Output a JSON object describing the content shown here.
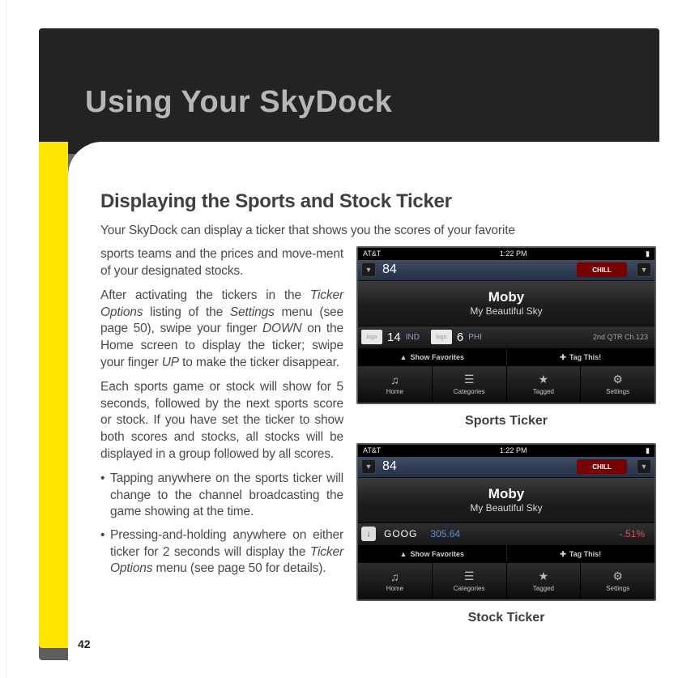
{
  "page": {
    "number": "42",
    "title": "Using Your SkyDock",
    "section_heading": "Displaying the Sports and Stock Ticker",
    "lead": "Your SkyDock can display a ticker that shows you the scores of your favorite",
    "para_rest1": "sports teams and the prices and move-ment of your designated stocks.",
    "para2_a": "After activating the tickers in the ",
    "para2_b": "Ticker Options",
    "para2_c": " listing of the ",
    "para2_d": "Settings",
    "para2_e": " menu (see page 50), swipe your finger ",
    "para2_f": "DOWN",
    "para2_g": " on the Home screen to display the ticker; swipe your finger ",
    "para2_h": "UP",
    "para2_i": " to make the ticker disappear.",
    "para3": "Each sports game or stock will show for 5 seconds, followed by the next sports score or stock. If you have set the ticker to show both scores and stocks, all stocks will be displayed in a group followed by all scores.",
    "bullet1": "Tapping anywhere on the sports ticker will change to the channel broadcasting the game showing at the time.",
    "bullet2_a": "Pressing-and-holding anywhere on either ticker for 2 seconds will display the ",
    "bullet2_b": "Ticker Options",
    "bullet2_c": " menu (see page 50 for details)."
  },
  "figures": {
    "sports_caption": "Sports Ticker",
    "stock_caption": "Stock Ticker"
  },
  "mock": {
    "status_left": "AT&T",
    "status_time": "1:22 PM",
    "channel": "84",
    "brand": "CHILL",
    "np_title": "Moby",
    "np_sub": "My Beautiful Sky",
    "sports": {
      "score1": "14",
      "team1": "IND",
      "score2": "6",
      "team2": "PHI",
      "quarter": "2nd QTR Ch.123"
    },
    "stock": {
      "symbol": "GOOG",
      "price": "305.64",
      "change": "-.51%"
    },
    "show_favorites": "Show Favorites",
    "tag_this": "Tag This!",
    "tabs": {
      "home": "Home",
      "categories": "Categories",
      "tagged": "Tagged",
      "settings": "Settings"
    },
    "logo_text": "logo"
  }
}
